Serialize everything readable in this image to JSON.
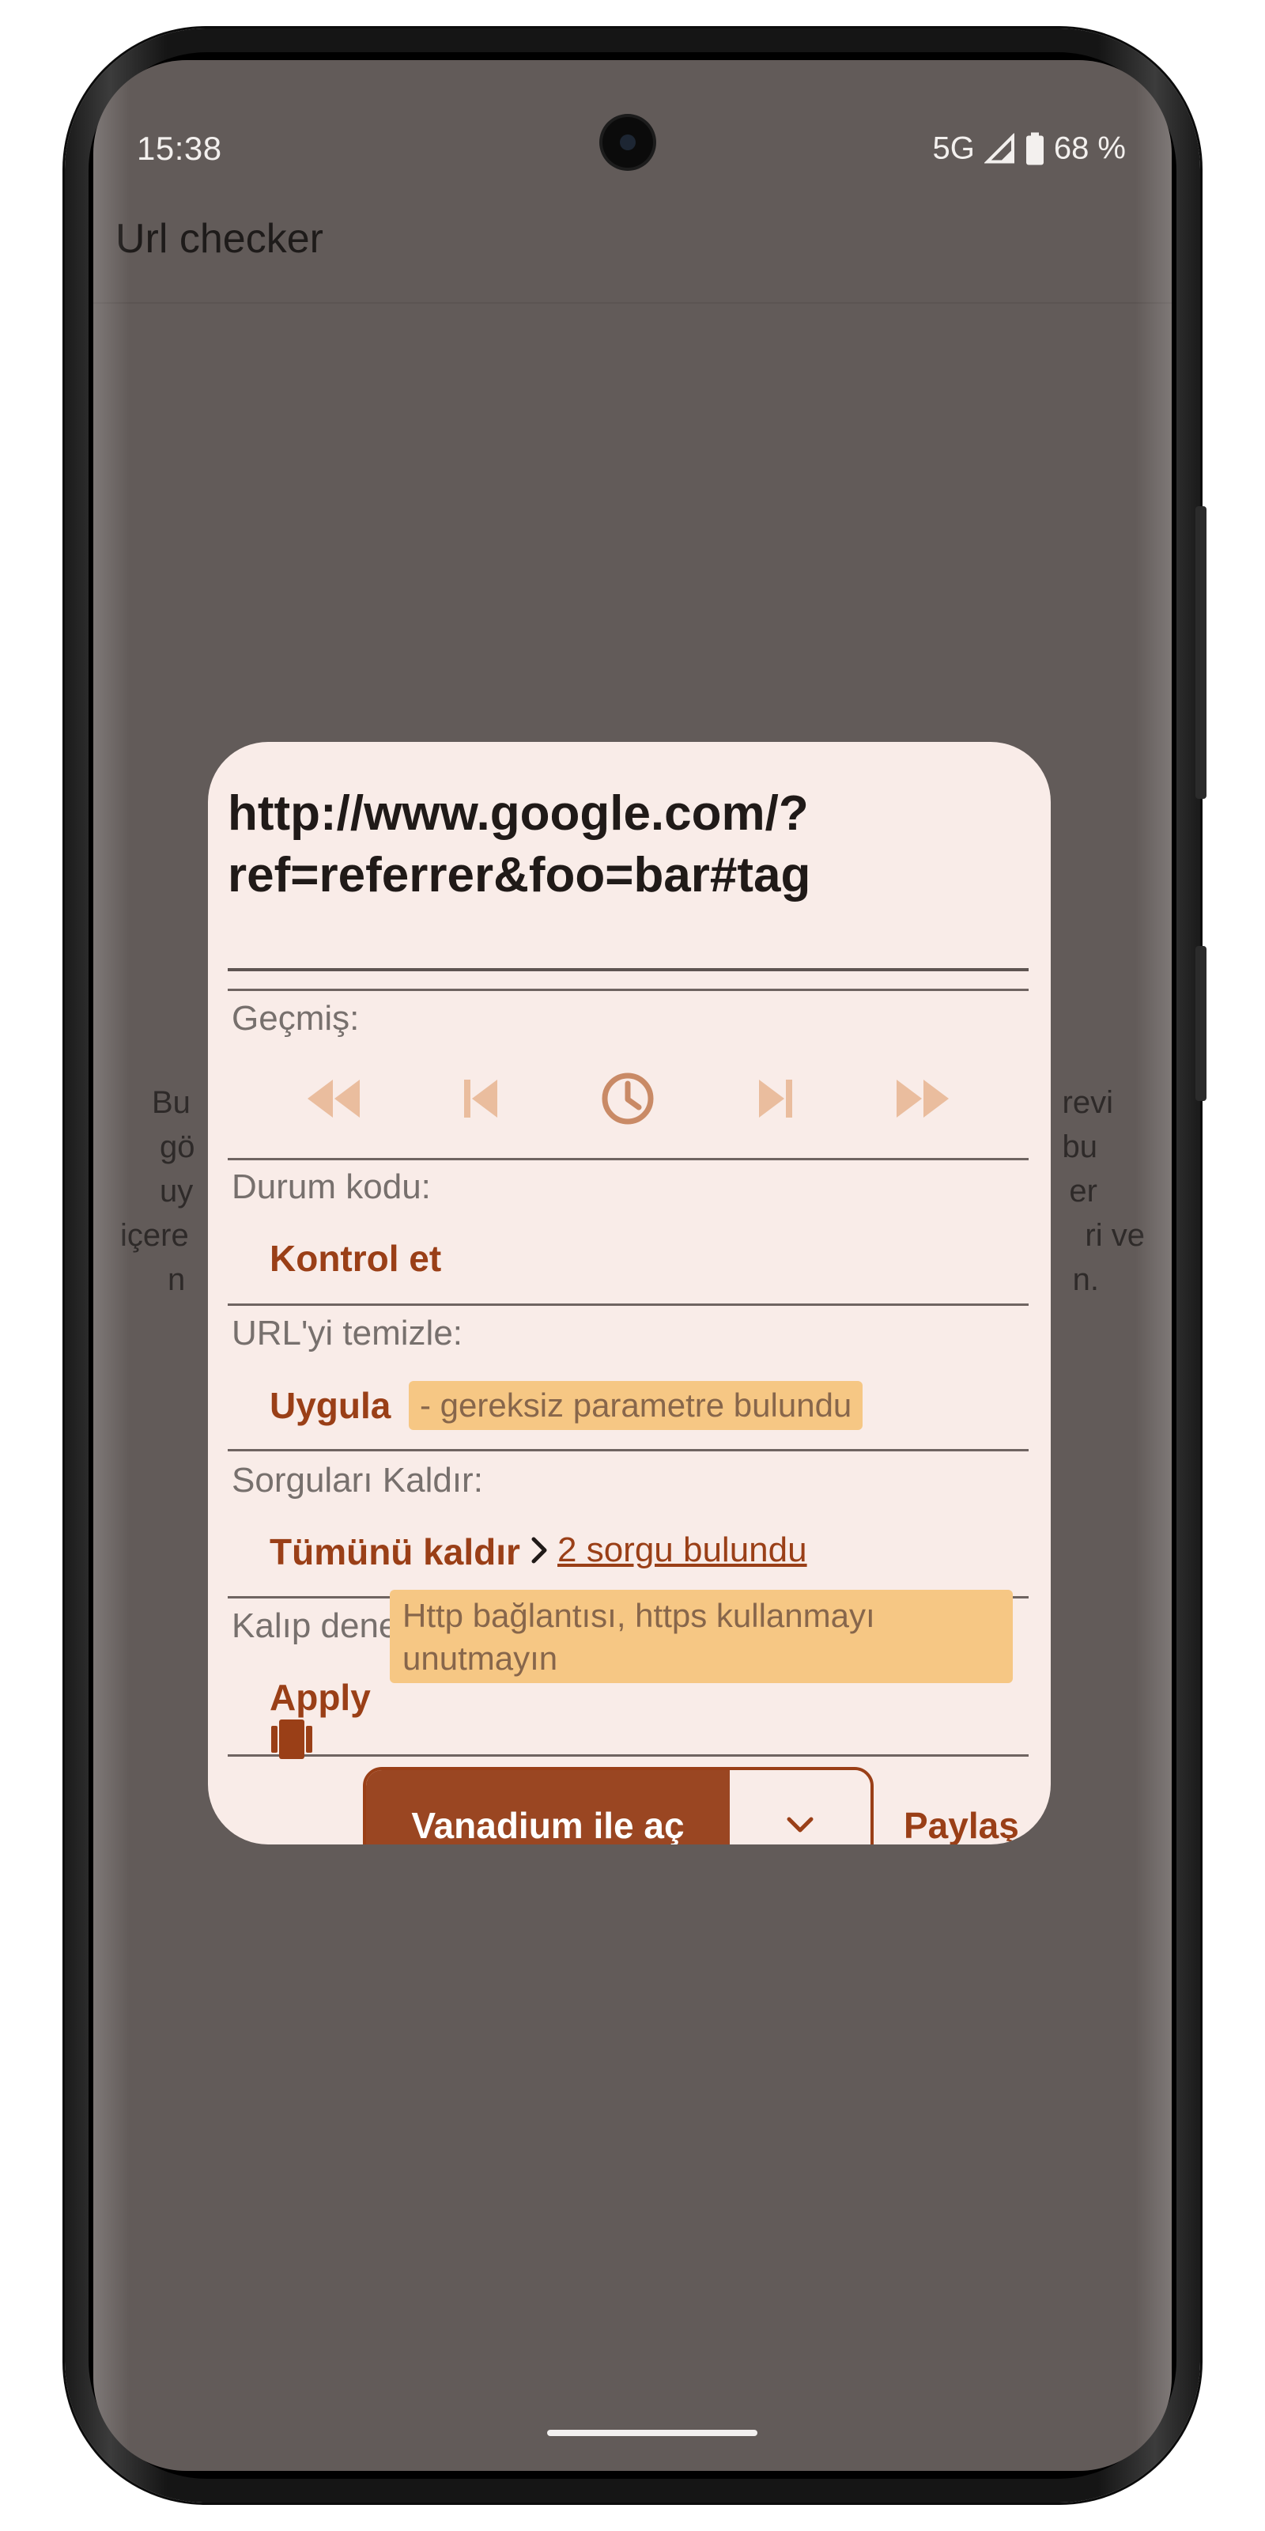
{
  "status_bar": {
    "time": "15:38",
    "network": "5G",
    "battery": "68 %"
  },
  "app": {
    "title": "Url checker"
  },
  "background_text": {
    "left_fragments": [
      "Bu",
      "gö",
      "uy",
      "içere",
      "n"
    ],
    "right_fragments": [
      "revi",
      "bu",
      "er",
      "ri ve",
      "n."
    ]
  },
  "dialog": {
    "url": "http://www.google.com/?ref=referrer&foo=bar#tag",
    "history": {
      "label": "Geçmiş:",
      "icons": [
        "rewind-icon",
        "skip-previous-icon",
        "history-clock-icon",
        "skip-next-icon",
        "fast-forward-icon"
      ]
    },
    "status_code": {
      "label": "Durum kodu:",
      "action": "Kontrol et"
    },
    "clear_url": {
      "label": "URL'yi temizle:",
      "action": "Uygula",
      "info": "- gereksiz parametre bulundu"
    },
    "remove_queries": {
      "label": "Sorguları Kaldır:",
      "action": "Tümünü kaldır",
      "link": "2 sorgu bulundu"
    },
    "pattern_checker": {
      "label": "Kalıp denetleyicisi:",
      "action": "Apply",
      "warning": "Http bağlantısı, https kullanmayı unutmayın"
    },
    "footer": {
      "open_label": "Vanadium ile aç",
      "share_label": "Paylaş"
    }
  },
  "colors": {
    "accent": "#9a3f17",
    "dialog_bg": "#f9ece8",
    "chip_bg": "#f6c784",
    "scrim": "#625b59"
  }
}
